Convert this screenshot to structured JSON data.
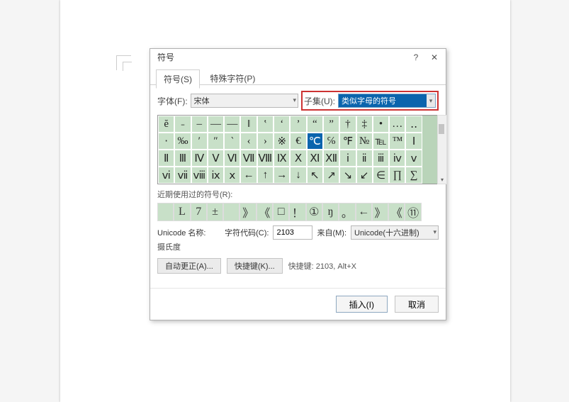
{
  "dialog": {
    "title": "符号",
    "tabs": [
      {
        "label": "符号(S)",
        "active": true
      },
      {
        "label": "特殊字符(P)",
        "active": false
      }
    ],
    "font_label": "字体(F):",
    "font_value": "宋体",
    "subset_label": "子集(U):",
    "subset_value": "类似字母的符号",
    "chars": [
      [
        "ĕ",
        "˗",
        "–",
        "—",
        "―",
        "‖",
        "‛",
        "‘",
        "’",
        "“",
        "”",
        "†",
        "‡",
        "•",
        "…",
        "‥"
      ],
      [
        "‧",
        "‰",
        "′",
        "″",
        "‵",
        "‹",
        "›",
        "※",
        "€",
        "℃",
        "℅",
        "℉",
        "№",
        "℡",
        "™",
        "Ⅰ"
      ],
      [
        "Ⅱ",
        "Ⅲ",
        "Ⅳ",
        "Ⅴ",
        "Ⅵ",
        "Ⅶ",
        "Ⅷ",
        "Ⅸ",
        "Ⅹ",
        "Ⅺ",
        "Ⅻ",
        "ⅰ",
        "ⅱ",
        "ⅲ",
        "ⅳ",
        "ⅴ"
      ],
      [
        "ⅵ",
        "ⅶ",
        "ⅷ",
        "ⅸ",
        "ⅹ",
        "←",
        "↑",
        "→",
        "↓",
        "↖",
        "↗",
        "↘",
        "↙",
        "∈",
        "∏",
        "∑"
      ]
    ],
    "selected": {
      "row": 1,
      "col": 9
    },
    "recent_label": "近期使用过的符号(R):",
    "recent": [
      "  ",
      "L",
      "7",
      "±",
      " ",
      "》",
      "《",
      "□",
      "！",
      "①",
      "ŋ",
      "。",
      "←",
      "》",
      "《",
      "⑪"
    ],
    "unicode_name_label": "Unicode 名称:",
    "unicode_name_value": "摄氏度",
    "code_label": "字符代码(C):",
    "code_value": "2103",
    "from_label": "来自(M):",
    "from_value": "Unicode(十六进制)",
    "autocorrect_btn": "自动更正(A)...",
    "shortcut_btn": "快捷键(K)...",
    "shortcut_text": "快捷键: 2103, Alt+X",
    "insert_btn": "插入(I)",
    "cancel_btn": "取消"
  }
}
